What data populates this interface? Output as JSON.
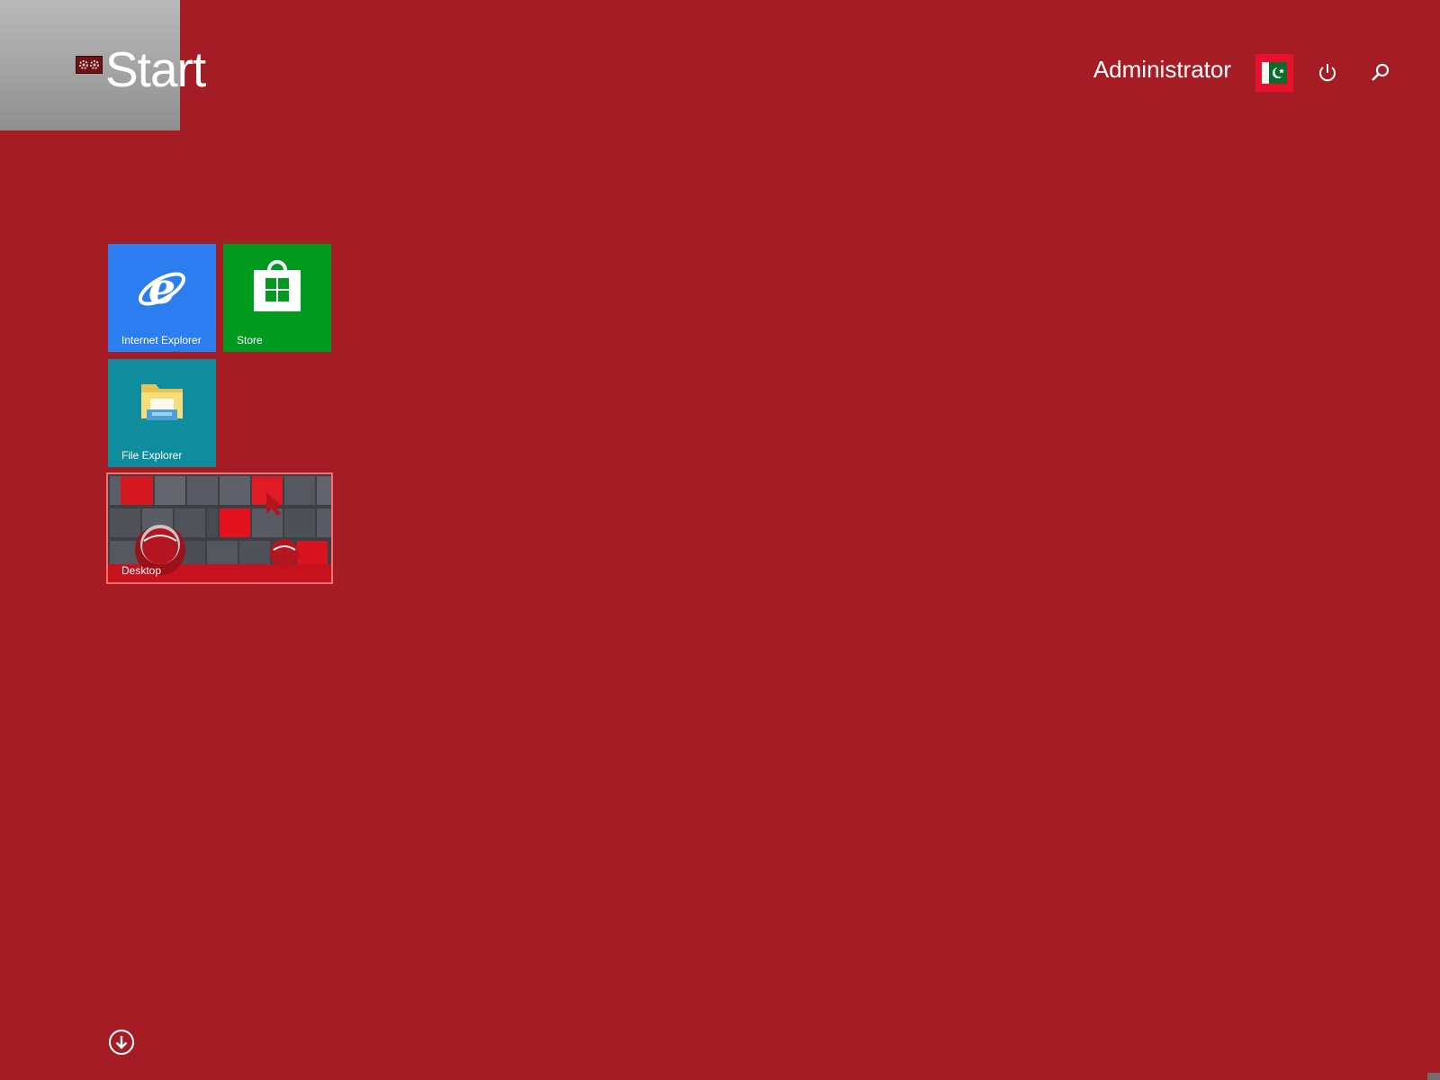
{
  "start": {
    "title": "Start"
  },
  "user": {
    "name": "Administrator"
  },
  "header_icons": {
    "power": "power-icon",
    "search": "search-icon",
    "avatar": "user-avatar"
  },
  "tiles": [
    {
      "label": "Internet Explorer",
      "icon": "internet-explorer-icon",
      "color": "#2b7df0"
    },
    {
      "label": "Store",
      "icon": "store-bag-icon",
      "color": "#009a1e"
    },
    {
      "label": "File Explorer",
      "icon": "folder-icon",
      "color": "#0f8d9e"
    },
    {
      "label": "Desktop",
      "icon": "desktop-wallpaper",
      "color": "#4a4c52"
    }
  ],
  "apps_view": {
    "icon": "down-arrow-circle-icon"
  },
  "colors": {
    "background": "#a51c24",
    "selection_border": "#ff6b6b",
    "avatar_bg": "#e8102d"
  }
}
